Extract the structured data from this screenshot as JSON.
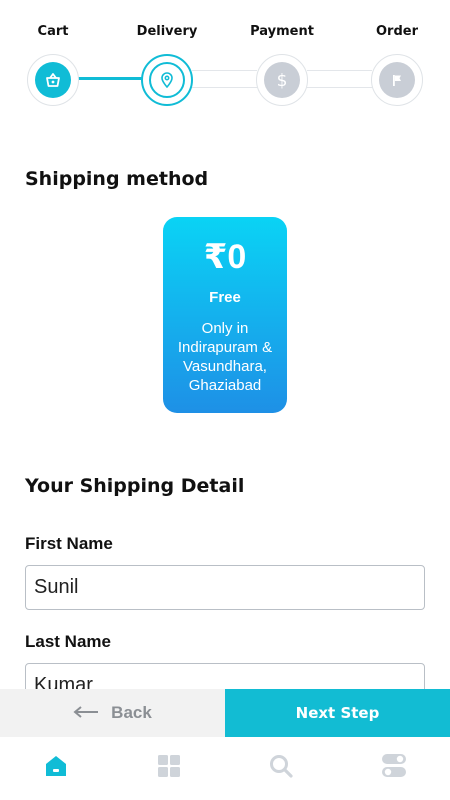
{
  "stepper": {
    "steps": [
      {
        "label": "Cart",
        "state": "complete",
        "icon": "basket-icon"
      },
      {
        "label": "Delivery",
        "state": "current",
        "icon": "location-pin-icon"
      },
      {
        "label": "Payment",
        "state": "pending",
        "icon": "dollar-icon"
      },
      {
        "label": "Order",
        "state": "pending",
        "icon": "flag-icon"
      }
    ]
  },
  "shipping_method": {
    "title": "Shipping method",
    "option": {
      "price": "₹0",
      "name": "Free",
      "description": "Only in Indirapuram & Vasundhara, Ghaziabad"
    }
  },
  "shipping_detail": {
    "title": "Your Shipping Detail",
    "first_name": {
      "label": "First Name",
      "value": "Sunil"
    },
    "last_name": {
      "label": "Last Name",
      "value": "Kumar"
    }
  },
  "actions": {
    "back_label": "Back",
    "next_label": "Next Step"
  },
  "bottom_nav": {
    "items": [
      {
        "icon": "home-icon",
        "active": true
      },
      {
        "icon": "grid-icon",
        "active": false
      },
      {
        "icon": "search-icon",
        "active": false
      },
      {
        "icon": "toggle-settings-icon",
        "active": false
      }
    ]
  },
  "colors": {
    "accent": "#10bcd6",
    "card_gradient_top": "#0ad3f5",
    "card_gradient_bottom": "#1e90e6",
    "inactive": "#c9ced6"
  }
}
